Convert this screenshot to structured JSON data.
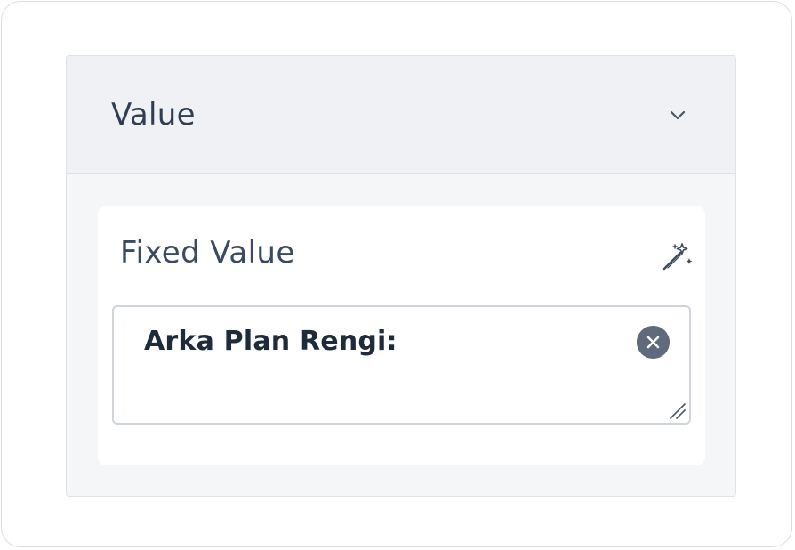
{
  "section": {
    "title": "Value"
  },
  "field": {
    "label": "Fixed Value",
    "value": "Arka Plan Rengi:"
  },
  "icons": {
    "collapse": "chevron-down-icon",
    "expression": "magic-wand-icon",
    "clear": "clear-circle-icon",
    "resize": "resize-grip-icon"
  },
  "colors": {
    "header_bg": "#eff1f4",
    "panel_bg": "#f4f6f8",
    "card_bg": "#ffffff",
    "title_text": "#2f3e52",
    "clear_button": "#5f6b7a"
  }
}
